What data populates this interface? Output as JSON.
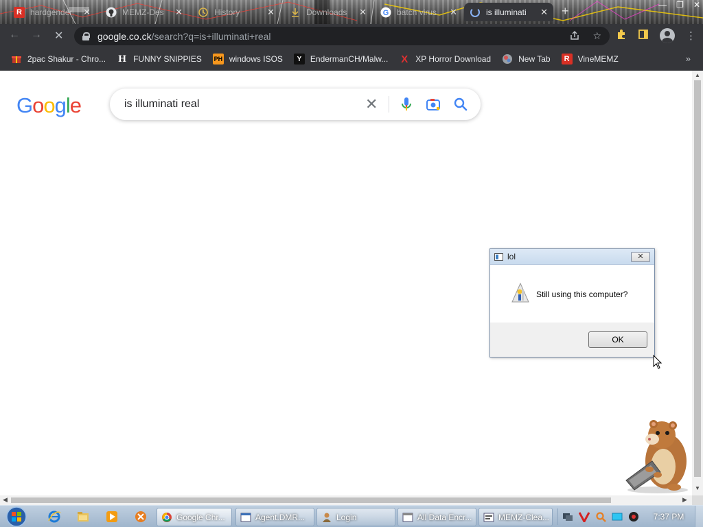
{
  "browser": {
    "tabs": [
      {
        "title": "hardgender",
        "favicon": "R"
      },
      {
        "title": "MEMZ-Des",
        "favicon": "github-icon"
      },
      {
        "title": "History",
        "favicon": "history-icon"
      },
      {
        "title": "Downloads",
        "favicon": "download-icon"
      },
      {
        "title": "batch virus",
        "favicon": "G"
      },
      {
        "title": "is illuminati",
        "favicon": "loading-spinner",
        "active": true
      }
    ],
    "new_tab_label": "+",
    "address": {
      "domain": "google.co.ck",
      "path": "/search?q=is+illuminati+real"
    },
    "bookmarks": [
      {
        "label": "2pac Shakur - Chro...",
        "icon": "gift-icon",
        "color": "#e8eaed"
      },
      {
        "label": "FUNNY SNIPPIES",
        "icon": "H",
        "color": "#ffffff"
      },
      {
        "label": "windows ISOS",
        "icon": "PH",
        "color": "#f7971d"
      },
      {
        "label": "EndermanCH/Malw...",
        "icon": "Y",
        "color": "#ffffff"
      },
      {
        "label": "XP Horror Download",
        "icon": "X",
        "color": "#e03030"
      },
      {
        "label": "New Tab",
        "icon": "globe-icon",
        "color": "#9aa0a6"
      },
      {
        "label": "VineMEMZ",
        "icon": "R",
        "color": "#d93025"
      }
    ],
    "bookmarks_more": "»"
  },
  "google": {
    "logo_letters": [
      {
        "ch": "G",
        "color": "#4285F4"
      },
      {
        "ch": "o",
        "color": "#EA4335"
      },
      {
        "ch": "o",
        "color": "#FBBC05"
      },
      {
        "ch": "g",
        "color": "#4285F4"
      },
      {
        "ch": "l",
        "color": "#34A853"
      },
      {
        "ch": "e",
        "color": "#EA4335"
      }
    ],
    "query": "is illuminati real"
  },
  "dialog": {
    "title": "lol",
    "message": "Still using this computer?",
    "ok_label": "OK",
    "close_label": "✕"
  },
  "taskbar": {
    "tasks": [
      {
        "label": "Google Chr...",
        "icon": "chrome-icon",
        "active": true
      },
      {
        "label": "Agent.DMR...",
        "icon": "window-icon"
      },
      {
        "label": "Login",
        "icon": "user-icon"
      },
      {
        "label": "All Data Encr...",
        "icon": "window-icon"
      },
      {
        "label": "MEMZ-Clea...",
        "icon": "window-icon"
      }
    ],
    "clock": "7:37 PM"
  }
}
